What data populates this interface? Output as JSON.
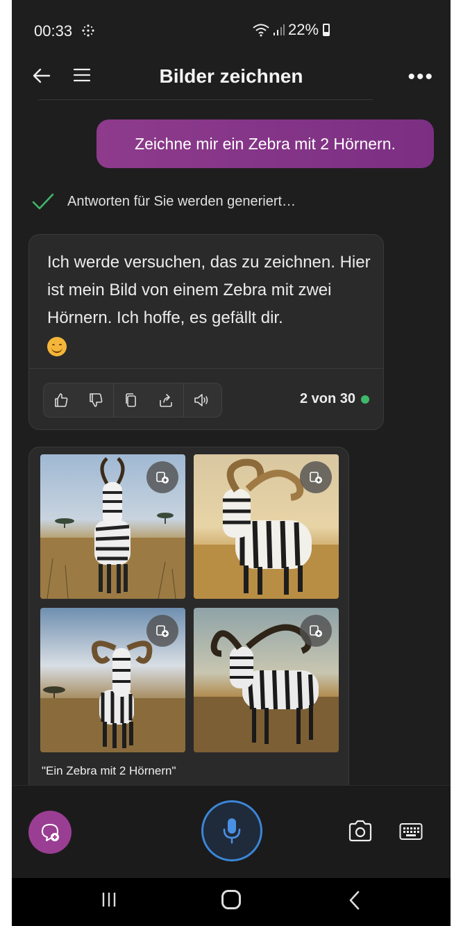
{
  "status_bar": {
    "time": "00:33",
    "battery": "22%"
  },
  "header": {
    "title": "Bilder zeichnen"
  },
  "chat": {
    "user_message": "Zeichne mir ein Zebra mit 2 Hörnern.",
    "status": "Antworten für Sie werden generiert…",
    "bot_message": "Ich werde versuchen, das zu zeichnen. Hier ist mein Bild von einem Zebra mit zwei Hörnern. Ich hoffe, es gefällt dir.",
    "counter": "2 von 30",
    "image_caption": "\"Ein Zebra mit 2 Hörnern\""
  },
  "icons": [
    "back-arrow-icon",
    "menu-icon",
    "more-icon",
    "check-icon",
    "thumbs-up-icon",
    "thumbs-down-icon",
    "copy-icon",
    "share-icon",
    "speaker-icon",
    "add-to-collection-icon",
    "new-topic-icon",
    "mic-icon",
    "camera-icon",
    "keyboard-icon"
  ],
  "colors": {
    "accent": "#8e3b8c",
    "mic_ring": "#3b86d6",
    "status_dot": "#3fb86a",
    "check": "#3fb86a"
  }
}
